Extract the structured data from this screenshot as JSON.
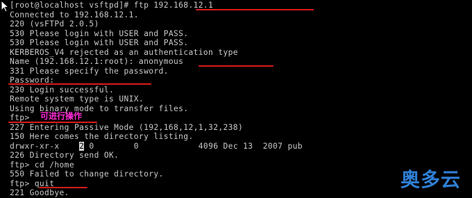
{
  "terminal": {
    "lines": [
      "[root@localhost vsftpd]# ftp 192.168.12.1",
      "Connected to 192.168.12.1.",
      "220 (vsFTPd 2.0.5)",
      "530 Please login with USER and PASS.",
      "530 Please login with USER and PASS.",
      "KERBEROS_V4 rejected as an authentication type",
      "Name (192.168.12.1:root): anonymous",
      "331 Please specify the password.",
      "Password:",
      "230 Login successful.",
      "Remote system type is UNIX.",
      "Using binary mode to transfer files.",
      "ftp> ",
      "227 Entering Passive Mode (192,168,12,1,32,238)",
      "150 Here comes the directory listing.",
      "",
      "226 Directory send OK.",
      "ftp> cd /home",
      "550 Failed to change directory.",
      "ftp> quit",
      "221 Goodbye."
    ],
    "listing_row": {
      "perms": "drwxr-xr-x",
      "links_highlighted": "2",
      "rest": " 0        0            4096 Dec 13  2007 pub"
    },
    "annotation": "可进行操作"
  },
  "watermark": "奥多云",
  "colors": {
    "background": "#000000",
    "text": "#c9c9c9",
    "underline": "#d81b1b",
    "annotation": "#ff2bd6",
    "watermark": "#2f7fd6"
  }
}
